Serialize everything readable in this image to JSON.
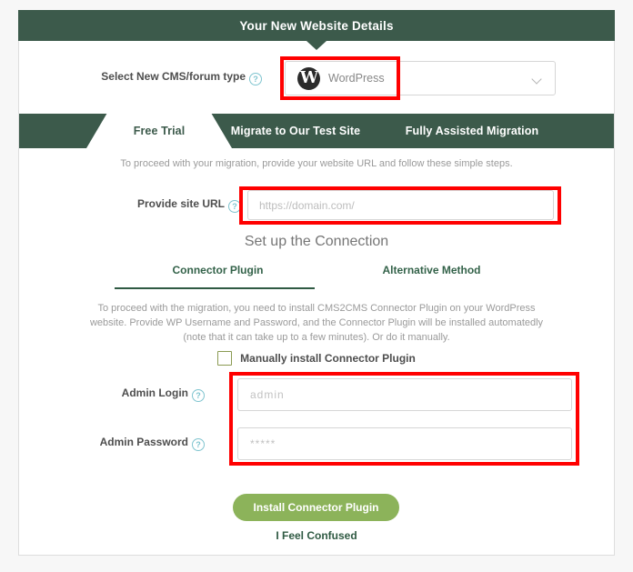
{
  "header": {
    "title": "Your New Website Details"
  },
  "cms_select": {
    "label": "Select New CMS/forum type",
    "help_glyph": "?",
    "selected": "WordPress",
    "logo_glyph": "W",
    "caret_icon": "chevron-down-icon"
  },
  "tabs": [
    {
      "label": "Free Trial",
      "active": true
    },
    {
      "label": "Migrate to Our Test Site",
      "active": false
    },
    {
      "label": "Fully Assisted Migration",
      "active": false
    }
  ],
  "intro_text": "To proceed with your migration, provide your website URL and follow these simple steps.",
  "site_url": {
    "label": "Provide site URL",
    "help_glyph": "?",
    "value": "",
    "placeholder": "https://domain.com/"
  },
  "setup": {
    "heading": "Set up the Connection",
    "subtabs": [
      {
        "label": "Connector Plugin",
        "active": true
      },
      {
        "label": "Alternative Method",
        "active": false
      }
    ],
    "body_note": "To proceed with the migration, you need to install CMS2CMS Connector Plugin on your WordPress website. Provide WP Username and Password, and the Connector Plugin will be installed automatedly (note that it can take up to a few minutes). Or do it manually.",
    "manual_checkbox": {
      "label": "Manually install Connector Plugin",
      "checked": false
    },
    "admin_login": {
      "label": "Admin Login",
      "help_glyph": "?",
      "value": "",
      "placeholder": "admin"
    },
    "admin_password": {
      "label": "Admin Password",
      "help_glyph": "?",
      "value": "",
      "placeholder": "*****"
    },
    "submit_label": "Install Connector Plugin",
    "confused_label": "I Feel Confused"
  },
  "colors": {
    "header_green": "#3c5a4b",
    "button_green": "#8cb35a",
    "link_green": "#2f5a43",
    "annotation_red": "#ff0000",
    "help_blue": "#7fc4cf",
    "checkbox_olive": "#8a9a52"
  }
}
